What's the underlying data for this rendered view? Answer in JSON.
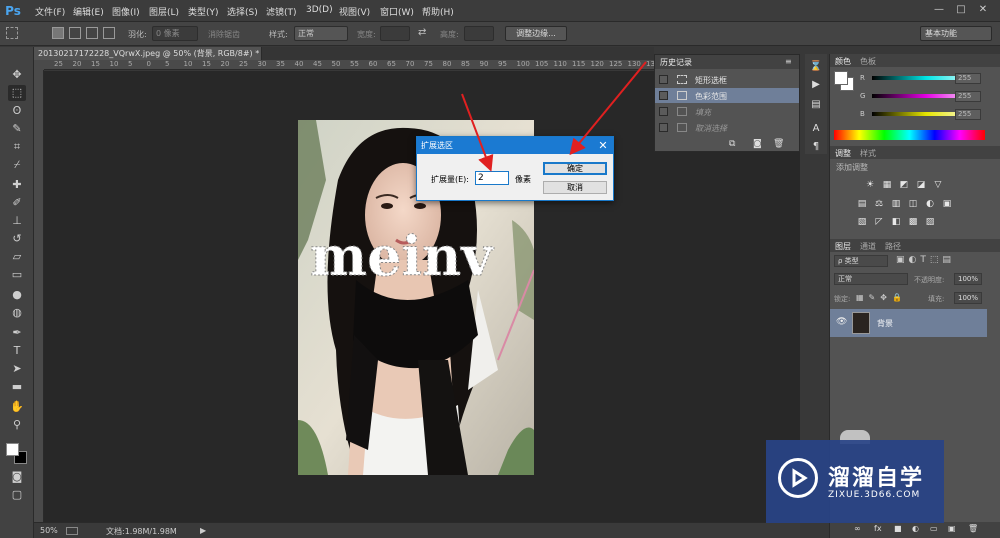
{
  "app": {
    "logo": "Ps"
  },
  "menu": [
    {
      "label": "文件(F)"
    },
    {
      "label": "编辑(E)"
    },
    {
      "label": "图像(I)"
    },
    {
      "label": "图层(L)"
    },
    {
      "label": "类型(Y)"
    },
    {
      "label": "选择(S)"
    },
    {
      "label": "滤镜(T)"
    },
    {
      "label": "3D(D)"
    },
    {
      "label": "视图(V)"
    },
    {
      "label": "窗口(W)"
    },
    {
      "label": "帮助(H)"
    }
  ],
  "window_controls": {
    "minimize": "—",
    "restore": "□",
    "close": "✕"
  },
  "options": {
    "feather_label": "羽化:",
    "feather_value": "0 像素",
    "antialias_label": "消除锯齿",
    "style_label": "样式:",
    "style_value": "正常",
    "width_label": "宽度:",
    "height_label": "高度:",
    "swap_icon": "⇄",
    "refine_edge": "调整边缘...",
    "workspace": "基本功能"
  },
  "document": {
    "tab_title": "20130217172228_VQrwX.jpeg @ 50% (背景, RGB/8#) *",
    "tab_close": "×",
    "ruler_h": [
      "25",
      "20",
      "15",
      "10",
      "5",
      "0",
      "5",
      "10",
      "15",
      "20",
      "25",
      "30",
      "35",
      "40",
      "45",
      "50",
      "55",
      "60",
      "65",
      "70",
      "75",
      "80",
      "85",
      "90",
      "95",
      "100",
      "105",
      "110",
      "115",
      "120",
      "125",
      "130",
      "135"
    ],
    "canvas_text": "meinv"
  },
  "status": {
    "zoom": "50%",
    "doc_info": "文档:1.98M/1.98M",
    "arrow": "▶"
  },
  "history": {
    "title": "历史记录",
    "items": [
      {
        "label": "矩形选框",
        "selected": false,
        "ghost": false
      },
      {
        "label": "色彩范围",
        "selected": true,
        "ghost": false
      },
      {
        "label": "填充",
        "selected": false,
        "ghost": true
      },
      {
        "label": "取消选择",
        "selected": false,
        "ghost": true
      }
    ]
  },
  "color_panel": {
    "tabs": [
      "颜色",
      "色板"
    ],
    "channels": [
      {
        "name": "R",
        "value": "255",
        "color": "#00e5e5"
      },
      {
        "name": "G",
        "value": "255",
        "color": "#e500e5"
      },
      {
        "name": "B",
        "value": "255",
        "color": "#e5e500"
      }
    ]
  },
  "adjustments": {
    "tabs": [
      "调整",
      "样式"
    ],
    "add_label": "添加调整",
    "icons": [
      "☀",
      "▦",
      "◩",
      "◪",
      "▽",
      "▤",
      "⚖",
      "▥",
      "◫",
      "◐",
      "▣",
      "♣",
      "▧",
      "◸",
      "◧",
      "▩",
      "▨"
    ]
  },
  "layers": {
    "tabs": [
      "图层",
      "通道",
      "路径"
    ],
    "kind": "ρ 类型",
    "blend_mode": "正常",
    "opacity_label": "不透明度:",
    "opacity_value": "100%",
    "lock_label": "锁定:",
    "fill_label": "填充:",
    "fill_value": "100%",
    "layer_name": "背景",
    "bottom_icons": [
      "∞",
      "fx",
      "■",
      "◐",
      "▭",
      "▣",
      "🗑"
    ]
  },
  "dialog": {
    "title": "扩展选区",
    "close": "✕",
    "label": "扩展量(E):",
    "value": "2",
    "unit": "像素",
    "ok": "确定",
    "cancel": "取消"
  },
  "watermark": {
    "title": "溜溜自学",
    "subtitle": "ZIXUE.3D66.COM"
  },
  "annotations": {
    "arrow_color": "#e02020"
  }
}
